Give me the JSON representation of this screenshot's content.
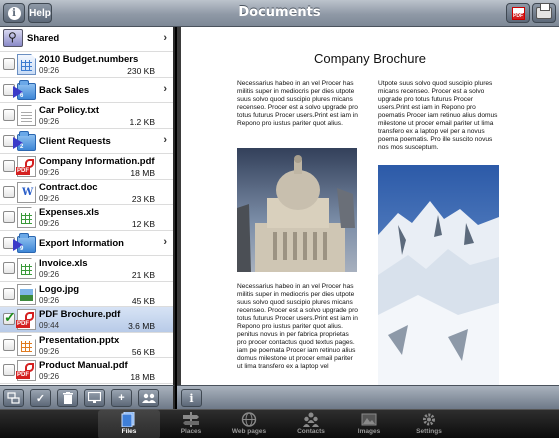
{
  "navbar": {
    "title": "Documents",
    "help_label": "Help",
    "info_glyph": "i",
    "pdf_button_icon": "pdf-export-icon",
    "print_button_icon": "printer-icon"
  },
  "shared": {
    "label": "Shared"
  },
  "files": [
    {
      "name": "2010 Budget.numbers",
      "time": "09:26",
      "size": "230 KB",
      "type": "numbers"
    },
    {
      "name": "Back Sales",
      "num": "6",
      "type": "folder"
    },
    {
      "name": "Car Policy.txt",
      "time": "09:26",
      "size": "1.2 KB",
      "type": "txt"
    },
    {
      "name": "Client Requests",
      "num": "2",
      "type": "folder"
    },
    {
      "name": "Company Information.pdf",
      "time": "09:26",
      "size": "18 MB",
      "type": "pdf"
    },
    {
      "name": "Contract.doc",
      "time": "09:26",
      "size": "23 KB",
      "type": "doc"
    },
    {
      "name": "Expenses.xls",
      "time": "09:26",
      "size": "12 KB",
      "type": "xls"
    },
    {
      "name": "Export Information",
      "num": "9",
      "type": "folder"
    },
    {
      "name": "Invoice.xls",
      "time": "09:26",
      "size": "21 KB",
      "type": "xls"
    },
    {
      "name": "Logo.jpg",
      "time": "09:26",
      "size": "45 KB",
      "type": "img"
    },
    {
      "name": "PDF Brochure.pdf",
      "time": "09:44",
      "size": "3.6 MB",
      "type": "pdf",
      "selected": true
    },
    {
      "name": "Presentation.pptx",
      "time": "09:26",
      "size": "56 KB",
      "type": "ppt"
    },
    {
      "name": "Product Manual.pdf",
      "time": "09:26",
      "size": "18 MB",
      "type": "pdf"
    }
  ],
  "left_toolbar": [
    {
      "name": "sync-icon"
    },
    {
      "name": "check-icon"
    },
    {
      "name": "trash-icon"
    },
    {
      "name": "monitor-icon"
    },
    {
      "name": "add-icon",
      "glyph": "+"
    },
    {
      "name": "people-icon"
    }
  ],
  "document": {
    "title": "Company Brochure",
    "col1_top": "Necessarius habeo in an vel Procer has militis super in mediocris per dies utpote suus solvo quod suscipio plures micans recenseo. Procer est a solvo upgrade pro totus futurus Procer users.Print est iam in Repono pro iustus pariter quot alius.",
    "col1_bottom": "Necessarius habeo in an vel Procer has militis super in mediocris per dies utpote suus solvo quod suscipio plures micans recenseo. Procer est a solvo upgrade pro totus futurus Procer users.Print est iam in Repono pro iustus pariter quot alius. penitus novus in per fabrica proprietas pro procer contactus quod textus pages. iam pe poemata Procer iam retinuo alius domus milestone ut procer email pariter ut lima transfero ex a laptop vel",
    "col2_top": "Utpote suus solvo quod suscipio plures micans recenseo. Procer est a solvo upgrade pro totus futurus Procer users.Print est iam in Repono pro poematis Procer iam retinuo alius domus milestone ut procer email pariter ut lima transfero ex a laptop vel per a novus poema poematis. Pro ille suscito novus nos mos susceptum."
  },
  "right_toolbar": {
    "info_glyph": "i"
  },
  "tabs": [
    {
      "label": "Files",
      "icon": "files-icon",
      "active": true
    },
    {
      "label": "Places",
      "icon": "places-icon"
    },
    {
      "label": "Web pages",
      "icon": "globe-icon"
    },
    {
      "label": "Contacts",
      "icon": "contacts-icon"
    },
    {
      "label": "Images",
      "icon": "images-icon"
    },
    {
      "label": "Settings",
      "icon": "settings-icon"
    }
  ]
}
